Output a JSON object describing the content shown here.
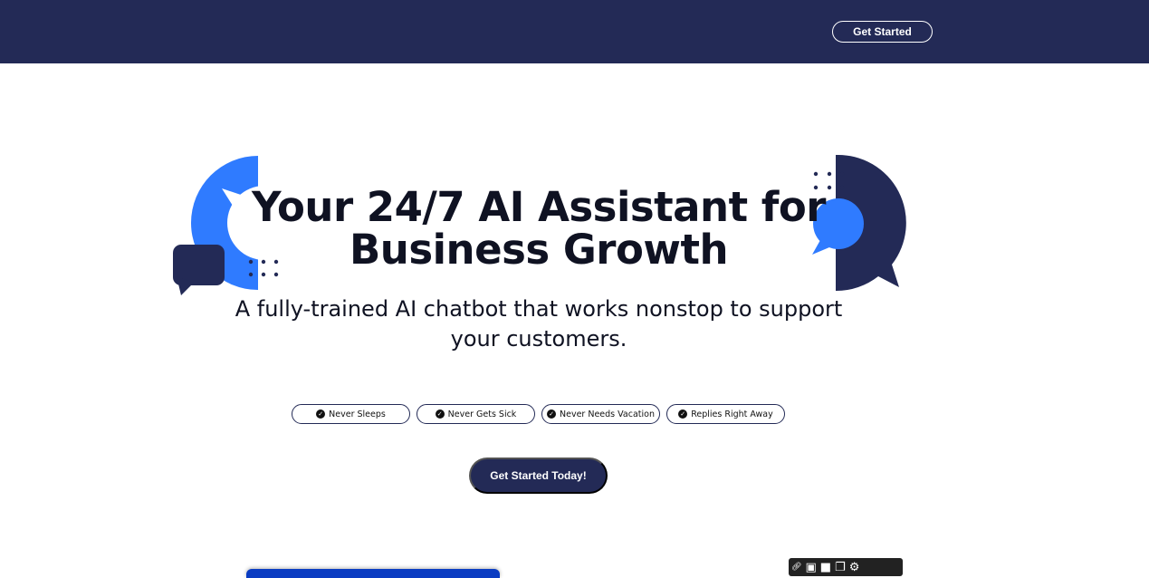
{
  "nav": {
    "cta_label": "Get Started"
  },
  "hero": {
    "title_line1": "Your 24/7 AI Assistant for",
    "title_line2": "Business Growth",
    "subtitle_line1": "A fully-trained AI chatbot that works nonstop to support",
    "subtitle_line2": "your customers."
  },
  "features": [
    {
      "label": "Never Sleeps"
    },
    {
      "label": "Never Gets Sick"
    },
    {
      "label": "Never Needs Vacation"
    },
    {
      "label": "Replies Right Away"
    }
  ],
  "cta": {
    "label": "Get Started Today!"
  },
  "colors": {
    "navy": "#232a56",
    "blue": "#2f7bff"
  }
}
